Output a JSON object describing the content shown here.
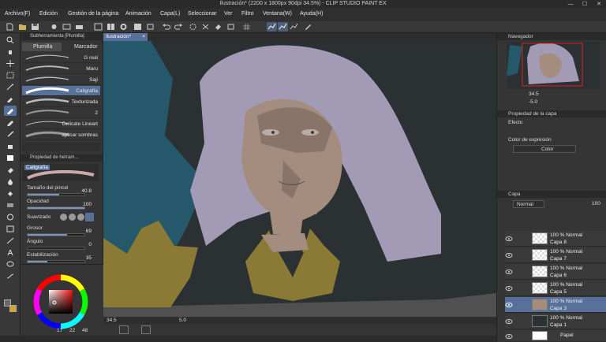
{
  "window": {
    "title": "Ilustración* (2200 x 1800px 90dpi 34.5%) - CLIP STUDIO PAINT EX",
    "minimize": "—",
    "maximize": "☐",
    "close": "✕"
  },
  "menu": [
    "Archivo(F)",
    "Edición",
    "Gestión de la página",
    "Animación",
    "Capa(L)",
    "Seleccionar",
    "Ver",
    "Filtro",
    "Ventana(W)",
    "Ayuda(H)"
  ],
  "subtool": {
    "header": "Subherramienta [Plumilla]",
    "tabs": [
      "Plumilla",
      "Marcador"
    ],
    "brushes": [
      {
        "name": "G real"
      },
      {
        "name": "Maru"
      },
      {
        "name": "Saji"
      },
      {
        "name": "Caligrafía"
      },
      {
        "name": "Texturizada"
      },
      {
        "name": "2"
      },
      {
        "name": "Delicate Lineart"
      },
      {
        "name": "aplicar sombras"
      }
    ]
  },
  "toolprops": {
    "header": "Propiedad de herram...",
    "brush_name": "Caligrafía",
    "rows": [
      {
        "label": "Tamaño del pincel",
        "value": "40.8",
        "fraction": 0.55
      },
      {
        "label": "Opacidad",
        "value": "100",
        "fraction": 1.0
      },
      {
        "label": "Suavizado",
        "value": ""
      },
      {
        "label": "Grosor",
        "value": "69",
        "fraction": 0.69
      },
      {
        "label": "Ángulo",
        "value": "0",
        "fraction": 0.0
      },
      {
        "label": "Estabilización",
        "value": "35",
        "fraction": 0.35
      }
    ]
  },
  "color": {
    "main": "#6a6a6a",
    "sub": "#d9a526",
    "values": [
      "17",
      "22",
      "48"
    ]
  },
  "canvas": {
    "tab": "Ilustración*",
    "close": "×",
    "zoom": "34.5",
    "size": "5.0"
  },
  "navigator": {
    "header": "Navegador",
    "zoom": "34.5",
    "rotate": "-5.0"
  },
  "layer_props": {
    "header": "Propiedad de la capa",
    "effect_label": "Efecto",
    "expression_label": "Color de expresión",
    "expression_value": "Color"
  },
  "layers": {
    "header": "Capa",
    "blend_mode": "Normal",
    "opacity": "100",
    "list": [
      {
        "mode": "100 % Normal",
        "name": "Capa 8",
        "selected": false
      },
      {
        "mode": "100 % Normal",
        "name": "Capa 7",
        "selected": false
      },
      {
        "mode": "100 % Normal",
        "name": "Capa 6",
        "selected": false
      },
      {
        "mode": "100 % Normal",
        "name": "Capa 5",
        "selected": false
      },
      {
        "mode": "100 % Normal",
        "name": "Capa 3",
        "selected": true
      },
      {
        "mode": "100 % Normal",
        "name": "Capa 1",
        "selected": false
      },
      {
        "mode": "",
        "name": "Papel",
        "selected": false
      }
    ]
  },
  "colors": {
    "accent": "#58719b",
    "bg": "#353535",
    "hair": "#a39bb5",
    "skin": "#a48d7f",
    "teal": "#24586a",
    "gold": "#8a7a36",
    "dark": "#2b3033"
  }
}
